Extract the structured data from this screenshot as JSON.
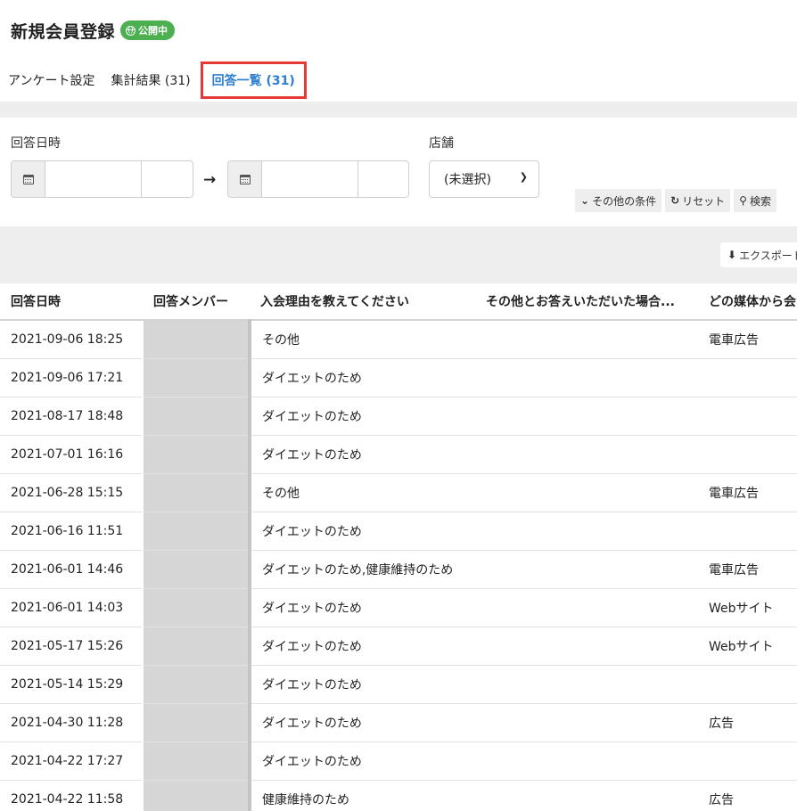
{
  "header": {
    "title": "新規会員登録",
    "status_badge": "公開中"
  },
  "tabs": [
    {
      "label": "アンケート設定"
    },
    {
      "label": "集計結果 (31)"
    },
    {
      "label": "回答一覧 (31)",
      "active": true
    }
  ],
  "filters": {
    "date_label": "回答日時",
    "store_label": "店舗",
    "store_selected": "(未選択)",
    "arrow_icon": "→",
    "more_conditions_label": "その他の条件",
    "reset_label": "リセット",
    "search_label": "検索"
  },
  "toolbar": {
    "export_label": "エクスポート"
  },
  "table": {
    "columns": [
      "回答日時",
      "回答メンバー",
      "入会理由を教えてください",
      "その他とお答えいただいた場合...",
      "どの媒体から会"
    ],
    "rows": [
      {
        "date": "2021-09-06 18:25",
        "reason": "その他",
        "other": "",
        "media": "電車広告"
      },
      {
        "date": "2021-09-06 17:21",
        "reason": "ダイエットのため",
        "other": "",
        "media": ""
      },
      {
        "date": "2021-08-17 18:48",
        "reason": "ダイエットのため",
        "other": "",
        "media": ""
      },
      {
        "date": "2021-07-01 16:16",
        "reason": "ダイエットのため",
        "other": "",
        "media": ""
      },
      {
        "date": "2021-06-28 15:15",
        "reason": "その他",
        "other": "",
        "media": "電車広告"
      },
      {
        "date": "2021-06-16 11:51",
        "reason": "ダイエットのため",
        "other": "",
        "media": ""
      },
      {
        "date": "2021-06-01 14:46",
        "reason": "ダイエットのため,健康維持のため",
        "other": "",
        "media": "電車広告"
      },
      {
        "date": "2021-06-01 14:03",
        "reason": "ダイエットのため",
        "other": "",
        "media": "Webサイト"
      },
      {
        "date": "2021-05-17 15:26",
        "reason": "ダイエットのため",
        "other": "",
        "media": "Webサイト"
      },
      {
        "date": "2021-05-14 15:29",
        "reason": "ダイエットのため",
        "other": "",
        "media": ""
      },
      {
        "date": "2021-04-30 11:28",
        "reason": "ダイエットのため",
        "other": "",
        "media": "広告"
      },
      {
        "date": "2021-04-22 17:27",
        "reason": "ダイエットのため",
        "other": "",
        "media": ""
      },
      {
        "date": "2021-04-22 11:58",
        "reason": "健康維持のため",
        "other": "",
        "media": "広告"
      }
    ]
  },
  "colors": {
    "badge_green": "#4caf50",
    "active_tab_text": "#2f7fcf",
    "highlight_red": "#e53935"
  }
}
